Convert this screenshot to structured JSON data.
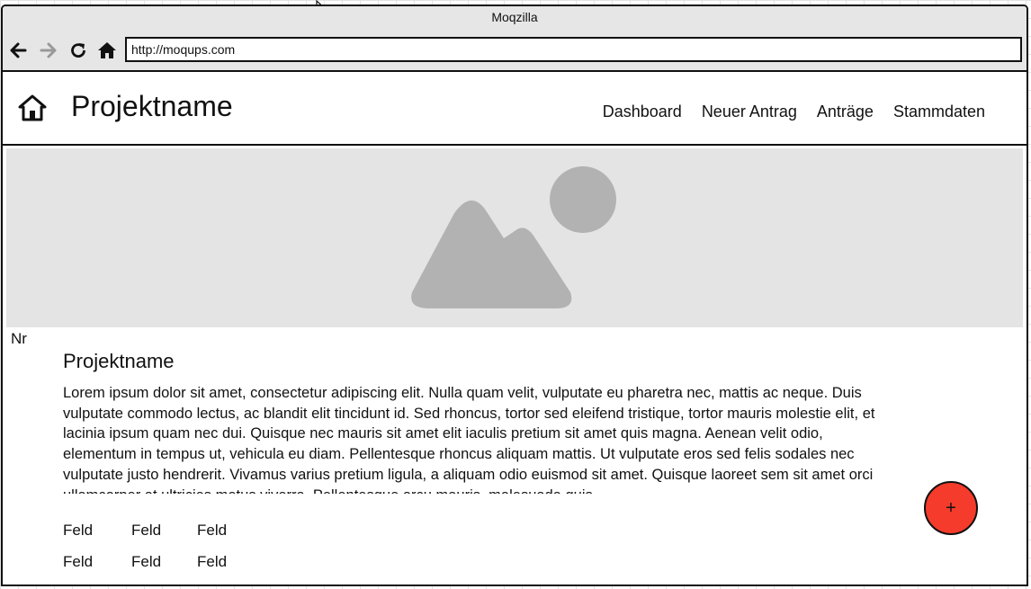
{
  "browser": {
    "title": "Moqzilla",
    "url": "http://moqups.com"
  },
  "header": {
    "project_title": "Projektname",
    "nav": [
      "Dashboard",
      "Neuer Antrag",
      "Anträge",
      "Stammdaten"
    ]
  },
  "content": {
    "nr_label": "Nr",
    "card_title": "Projektname",
    "card_text": "Lorem ipsum dolor sit amet, consectetur adipiscing elit. Nulla quam velit, vulputate eu pharetra nec, mattis ac neque. Duis vulputate commodo lectus, ac blandit elit tincidunt id. Sed rhoncus, tortor sed eleifend tristique, tortor mauris molestie elit, et lacinia ipsum quam nec dui. Quisque nec mauris sit amet elit iaculis pretium sit amet quis magna. Aenean velit odio, elementum in tempus ut, vehicula eu diam. Pellentesque rhoncus aliquam mattis. Ut vulputate eros sed felis sodales nec vulputate justo hendrerit. Vivamus varius pretium ligula, a aliquam odio euismod sit amet. Quisque laoreet sem sit amet orci ullamcorper at ultricies metus viverra. Pellentesque arcu mauris, malesuada quis.",
    "fields": [
      [
        "Feld",
        "Feld",
        "Feld"
      ],
      [
        "Feld",
        "Feld",
        "Feld"
      ]
    ]
  },
  "fab": {
    "label": "+",
    "color": "#f53b2b"
  },
  "icons": {
    "back": "arrow-left-icon",
    "forward": "arrow-right-icon",
    "reload": "reload-icon",
    "browser_home": "home-icon",
    "app_home": "home-outline-icon",
    "hero": "image-placeholder-icon"
  }
}
